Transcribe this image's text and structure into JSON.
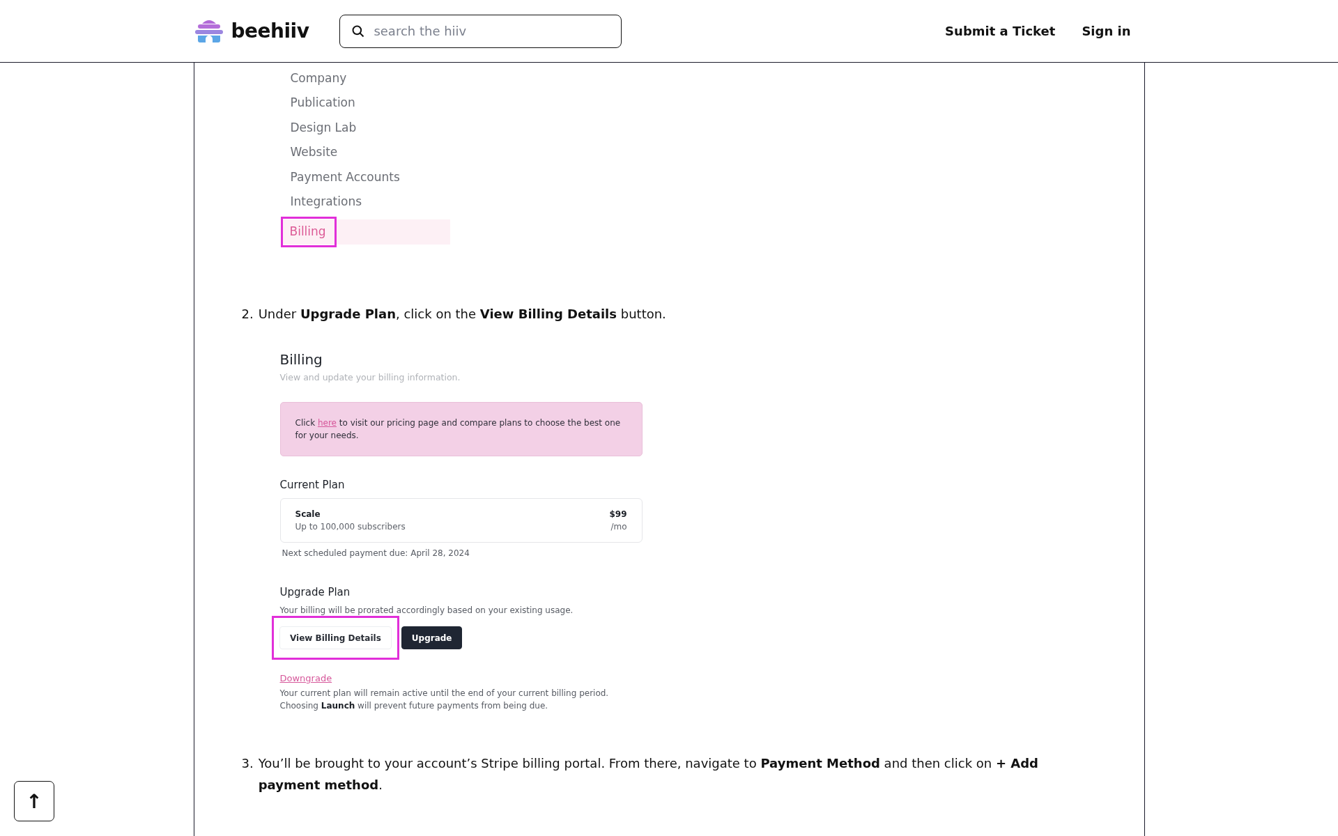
{
  "header": {
    "logo": "beehiiv",
    "search": {
      "placeholder": "search the hiiv"
    },
    "links": [
      "Submit a Ticket",
      "Sign in"
    ]
  },
  "settings_nav": {
    "items": [
      {
        "label": "Company",
        "selected": false,
        "annotated": false
      },
      {
        "label": "Publication",
        "selected": false,
        "annotated": false
      },
      {
        "label": "Design Lab",
        "selected": false,
        "annotated": false
      },
      {
        "label": "Website",
        "selected": false,
        "annotated": false
      },
      {
        "label": "Payment Accounts",
        "selected": false,
        "annotated": false
      },
      {
        "label": "Integrations",
        "selected": false,
        "annotated": false
      },
      {
        "label": "Billing",
        "selected": true,
        "annotated": true
      }
    ]
  },
  "step_2": {
    "number": "2.",
    "text": "Under **Upgrade Plan**, click on the **View Billing Details** button."
  },
  "billing_screen": {
    "title": "Billing",
    "subtitle": "View and update your billing information.",
    "notice": {
      "before": "Click",
      "link": "here",
      "after": "to visit our pricing page and compare plans to choose the best one for your needs."
    },
    "current_plan": {
      "heading": "Current Plan",
      "name": "Scale",
      "description": "Up to 100,000 subscribers",
      "price": "$99",
      "period": "/mo",
      "next_payment": "Next scheduled payment due: April 28, 2024"
    },
    "upgrade_plan": {
      "heading": "Upgrade Plan",
      "description": "Your billing will be prorated accordingly based on your existing usage.",
      "buttons": [
        {
          "label": "View Billing Details",
          "kind": "secondary",
          "annotated": true
        },
        {
          "label": "Upgrade",
          "kind": "primary",
          "annotated": false
        }
      ]
    },
    "downgrade": {
      "link": "Downgrade",
      "text": "Your current plan will remain active until the end of your current billing period. Choosing **Launch** will prevent future payments from being due."
    }
  },
  "step_3": {
    "number": "3.",
    "text": "You’ll be brought to your account’s Stripe billing portal. From there, navigate to **Payment Method** and then click on **+ Add payment method**."
  },
  "back_to_top": {
    "label": "↑"
  }
}
